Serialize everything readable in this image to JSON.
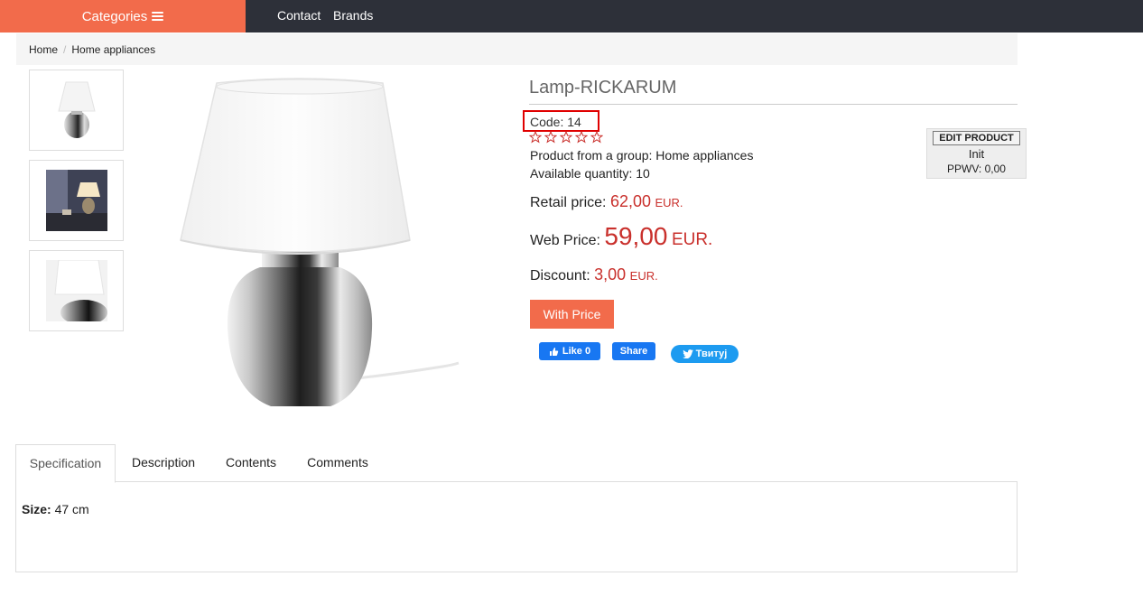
{
  "nav": {
    "categories_label": "Categories",
    "links": [
      "Contact",
      "Brands"
    ]
  },
  "breadcrumb": [
    "Home",
    "Home appliances"
  ],
  "product": {
    "title": "Lamp-RICKARUM",
    "code_label": "Code:",
    "code": "14",
    "rating": 0,
    "rating_max": 5,
    "group_label": "Product from a group:",
    "group": "Home appliances",
    "qty_label": "Available quantity:",
    "qty": "10",
    "retail_label": "Retail price:",
    "retail_value": "62,00",
    "web_label": "Web Price:",
    "web_value": "59,00",
    "discount_label": "Discount:",
    "discount_value": "3,00",
    "currency": "EUR.",
    "cta_label": "With Price"
  },
  "social": {
    "fb_like": "Like 0",
    "fb_share": "Share",
    "tweet": "Твитуј"
  },
  "admin": {
    "edit_label": "EDIT PRODUCT",
    "line1": "Init",
    "line2": "PPWV: 0,00"
  },
  "tabs": [
    "Specification",
    "Description",
    "Contents",
    "Comments"
  ],
  "spec": {
    "label": "Size:",
    "value": "47 cm"
  },
  "colors": {
    "accent": "#f26b4b",
    "nav_bg": "#2d3039",
    "price_red": "#c9302c",
    "facebook": "#1877f2",
    "twitter": "#1d9bf0"
  }
}
